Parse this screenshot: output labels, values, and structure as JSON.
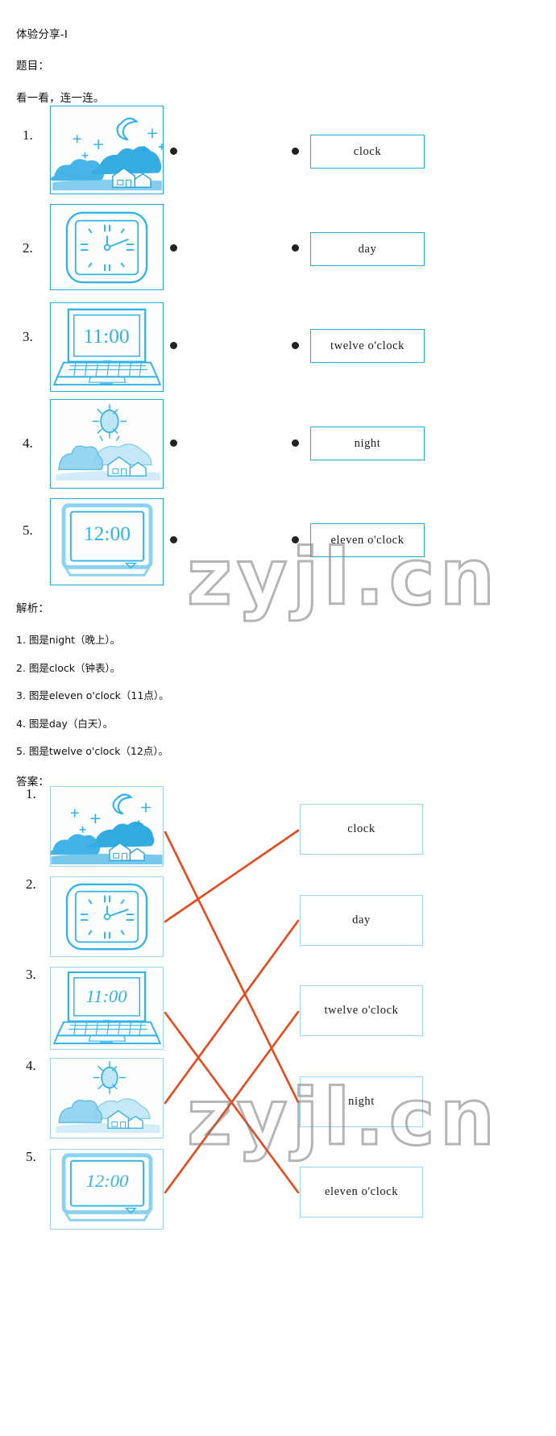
{
  "header": {
    "title": "体验分享-I",
    "prompt_label": "题目：",
    "instruction": "看一看，连一连。"
  },
  "exercise": {
    "items": [
      {
        "number": "1.",
        "picture": "night-scene-moon-stars-houses",
        "alt": "moon and stars over houses at night"
      },
      {
        "number": "2.",
        "picture": "wall-clock",
        "alt": "square wall clock"
      },
      {
        "number": "3.",
        "picture": "laptop-1100",
        "alt": "laptop showing 11:00",
        "screen_text": "11:00"
      },
      {
        "number": "4.",
        "picture": "day-scene-sun-houses",
        "alt": "sun over trees and houses in daytime"
      },
      {
        "number": "5.",
        "picture": "monitor-1200",
        "alt": "monitor showing 12:00",
        "screen_text": "12:00"
      }
    ],
    "words": [
      "clock",
      "day",
      "twelve  o'clock",
      "night",
      "eleven  o'clock"
    ]
  },
  "analysis": {
    "label": "解析：",
    "lines": [
      "1. 图是night（晚上）。",
      "2. 图是clock（钟表）。",
      "3. 图是eleven o'clock（11点）。",
      "4. 图是day（白天）。",
      "5. 图是twelve o'clock（12点）。"
    ]
  },
  "answer": {
    "label": "答案：",
    "items": [
      {
        "number": "1.",
        "picture": "night-scene-moon-stars-houses",
        "screen_text": ""
      },
      {
        "number": "2.",
        "picture": "wall-clock",
        "screen_text": ""
      },
      {
        "number": "3.",
        "picture": "laptop-1100",
        "screen_text": "11:00"
      },
      {
        "number": "4.",
        "picture": "day-scene-sun-houses",
        "screen_text": ""
      },
      {
        "number": "5.",
        "picture": "monitor-1200",
        "screen_text": "12:00"
      }
    ],
    "words": [
      "clock",
      "day",
      "twelve  o'clock",
      "night",
      "eleven  o'clock"
    ],
    "matches": [
      {
        "from": 1,
        "to": "night"
      },
      {
        "from": 2,
        "to": "clock"
      },
      {
        "from": 3,
        "to": "eleven  o'clock"
      },
      {
        "from": 4,
        "to": "day"
      },
      {
        "from": 5,
        "to": "twelve  o'clock"
      }
    ],
    "line_color": "#e8491c"
  },
  "watermark": {
    "text": "zyjl.cn",
    "display": "zyjl.cn"
  },
  "colors": {
    "box_border": "#29a8e0",
    "answer_box_border": "#9ed8f0",
    "art": "#34b3e8",
    "line": "#e8491c"
  }
}
